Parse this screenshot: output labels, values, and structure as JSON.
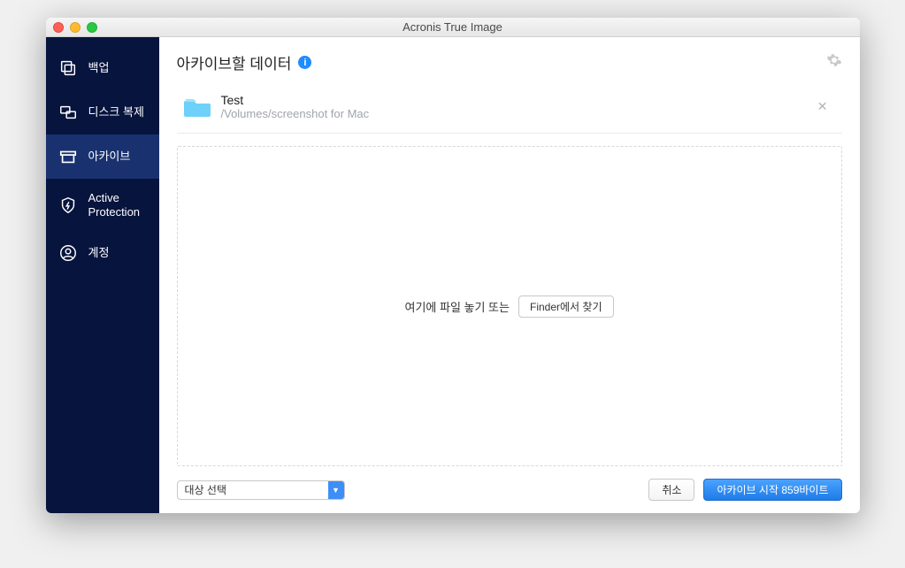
{
  "titlebar": {
    "title": "Acronis True Image"
  },
  "sidebar": {
    "items": [
      {
        "label": "백업"
      },
      {
        "label": "디스크 복제"
      },
      {
        "label": "아카이브"
      },
      {
        "label_line1": "Active",
        "label_line2": "Protection"
      },
      {
        "label": "계정"
      }
    ]
  },
  "page": {
    "title": "아카이브할 데이터",
    "info_glyph": "i"
  },
  "file": {
    "name": "Test",
    "path": "/Volumes/screenshot for Mac"
  },
  "dropzone": {
    "text": "여기에 파일 놓기 또는",
    "finder_button": "Finder에서 찾기"
  },
  "footer": {
    "destination_placeholder": "대상 선택",
    "cancel": "취소",
    "start": "아카이브 시작 859바이트"
  }
}
